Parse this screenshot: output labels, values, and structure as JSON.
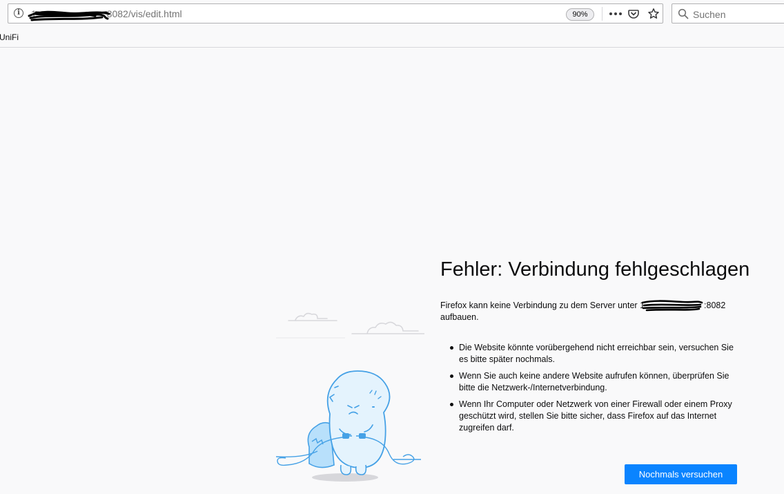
{
  "toolbar": {
    "url_visible": "1",
    "url_suffix": ".8082/vis/edit.html",
    "zoom": "90%",
    "search_placeholder": "Suchen",
    "icons": [
      "info-icon",
      "page-actions-icon",
      "pocket-icon",
      "bookmark-star-icon",
      "search-icon"
    ]
  },
  "bookmarks": {
    "items": [
      {
        "label": "UniFi"
      }
    ]
  },
  "error": {
    "title": "Fehler: Verbindung fehlgeschlagen",
    "description_prefix": "Firefox kann keine Verbindung zu dem Server unter",
    "server_visible": "1",
    "server_port": ":8082",
    "description_suffix": "aufbauen.",
    "bullets": [
      "Die Website könnte vorübergehend nicht erreichbar sein, versuchen Sie es bitte später nochmals.",
      "Wenn Sie auch keine andere Website aufrufen können, überprüfen Sie bitte die Netzwerk-/Internetverbindung.",
      "Wenn Ihr Computer oder Netzwerk von einer Firewall oder einem Proxy geschützt wird, stellen Sie bitte sicher, dass Firefox auf das Internet zugreifen darf."
    ],
    "retry_label": "Nochmals versuchen"
  },
  "colors": {
    "accent": "#0a84ff",
    "illustration": "#45a1e6",
    "background": "#f9f9fa"
  }
}
